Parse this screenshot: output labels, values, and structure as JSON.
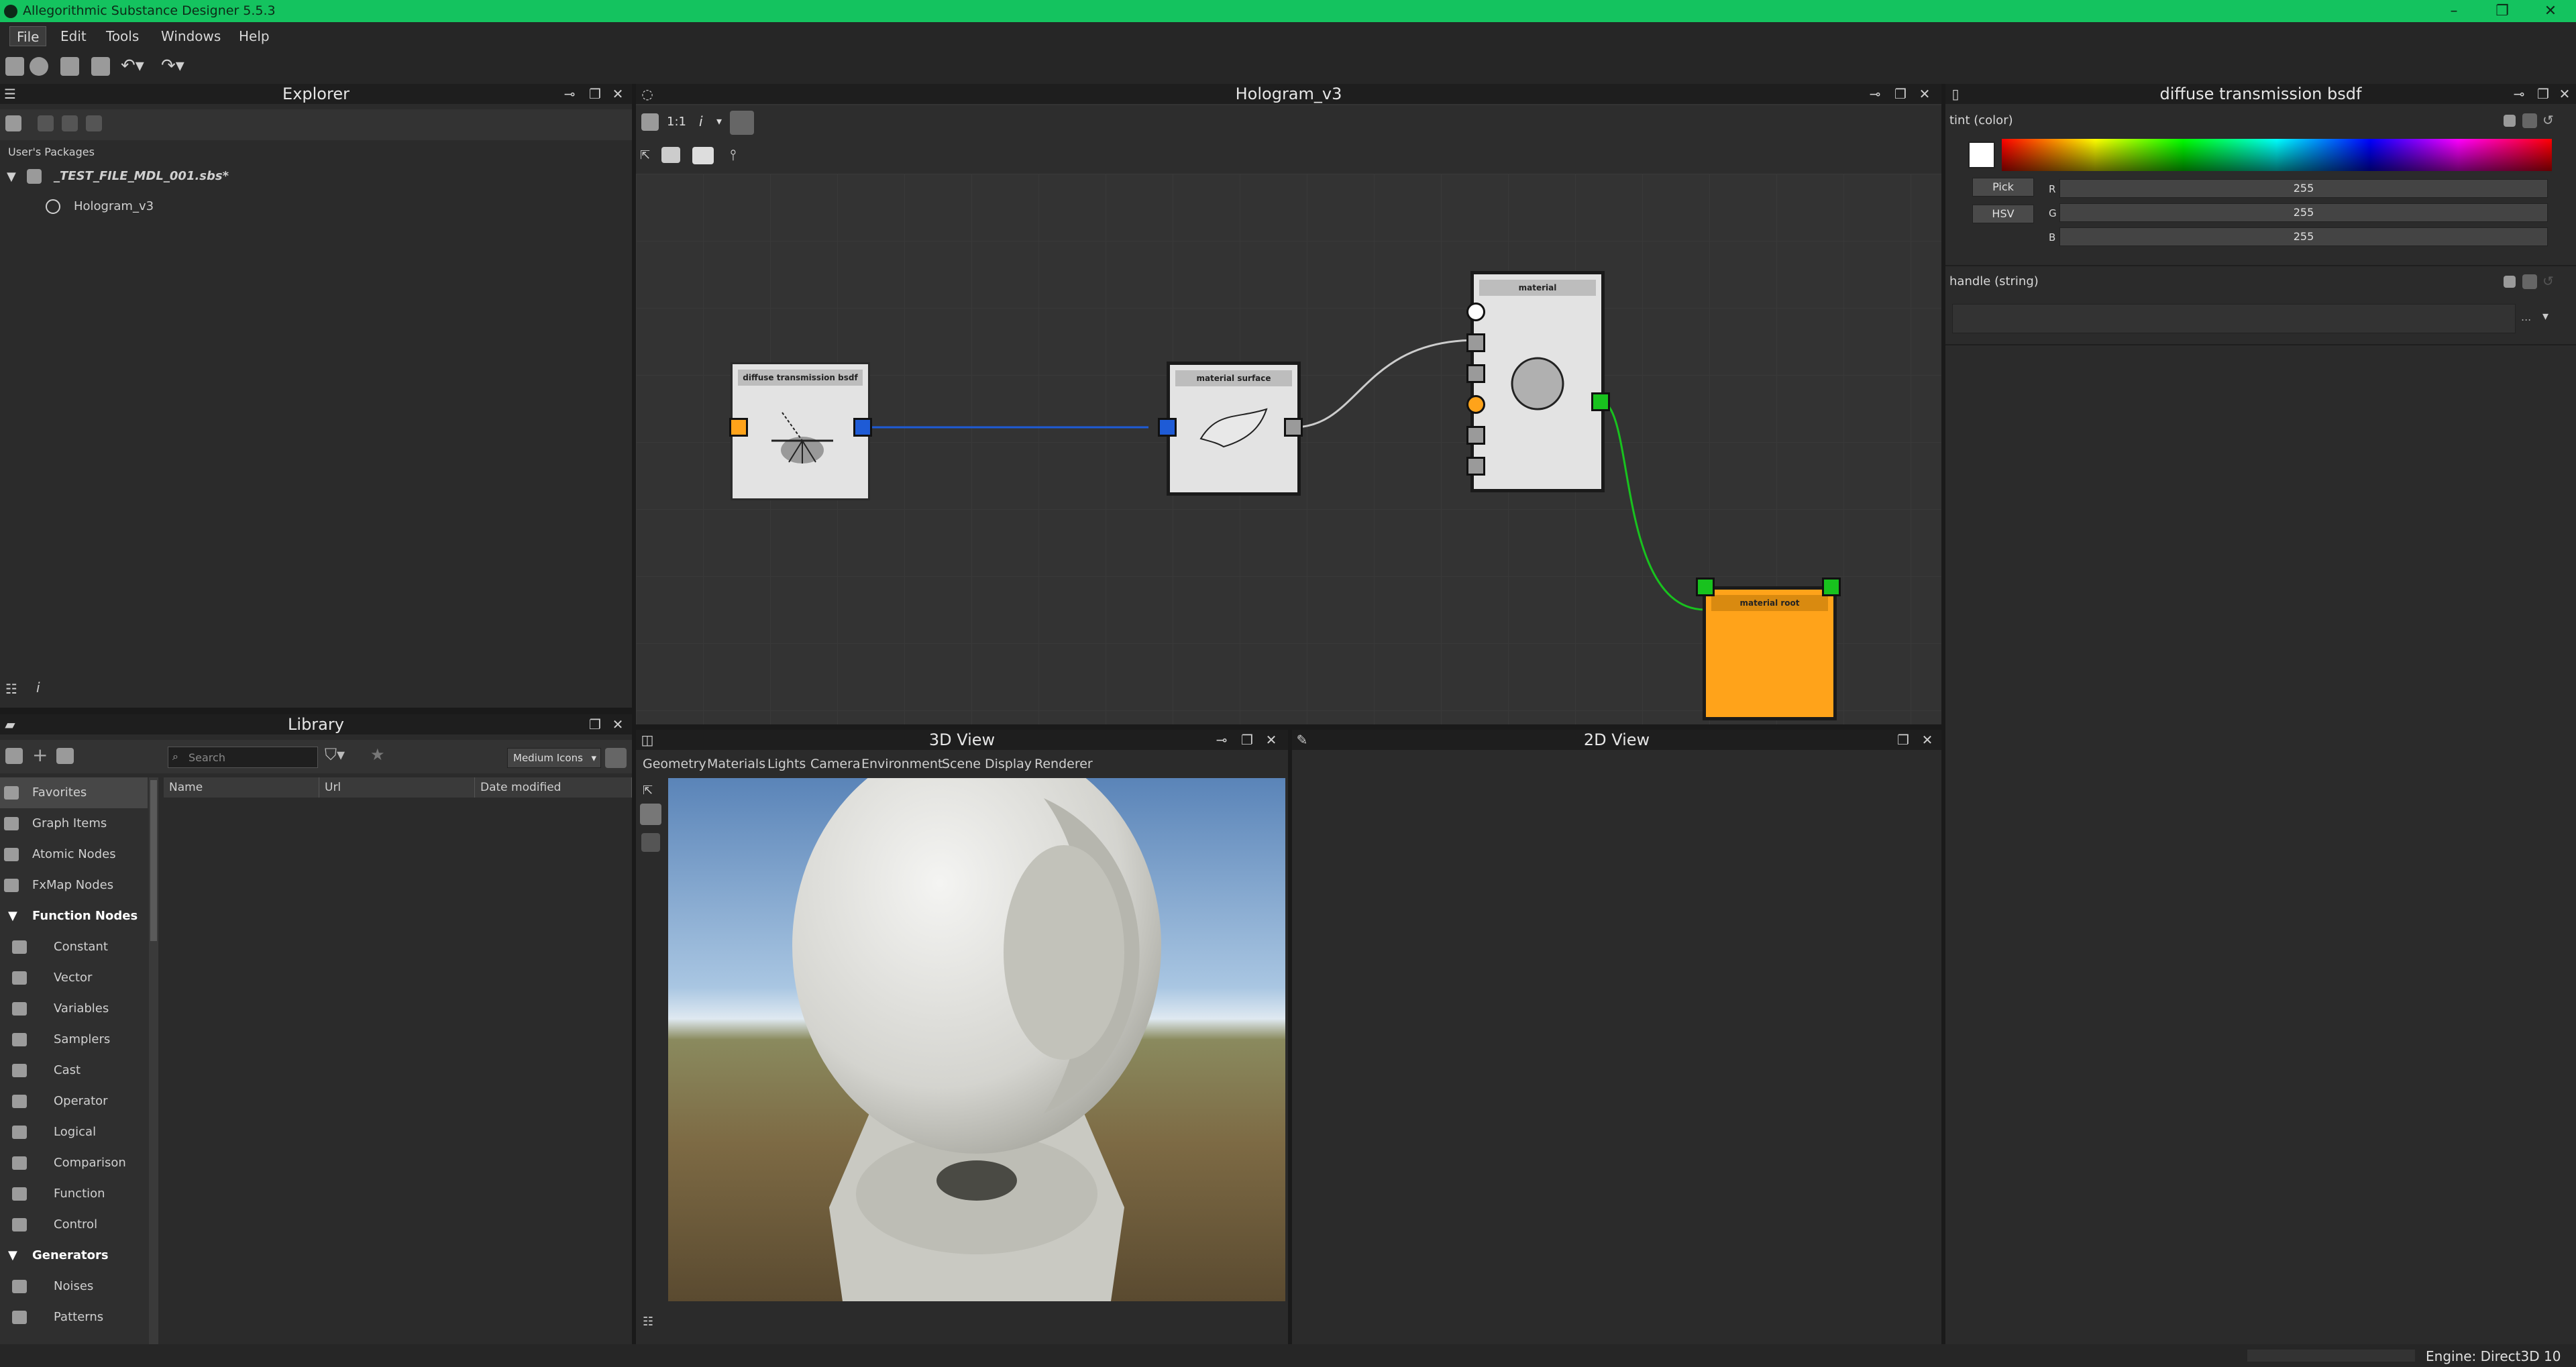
{
  "window": {
    "title": "Allegorithmic Substance Designer 5.5.3"
  },
  "menu": {
    "file": "File",
    "edit": "Edit",
    "tools": "Tools",
    "windows": "Windows",
    "help": "Help"
  },
  "explorer": {
    "title": "Explorer",
    "section": "User's Packages",
    "package": "_TEST_FILE_MDL_001.sbs*",
    "graph": "Hologram_v3"
  },
  "library": {
    "title": "Library",
    "search_placeholder": "Search",
    "view_mode": "Medium Icons",
    "columns": [
      "Name",
      "Url",
      "Date modified"
    ],
    "items": [
      {
        "label": "Favorites",
        "type": "top",
        "selected": true
      },
      {
        "label": "Graph Items",
        "type": "top"
      },
      {
        "label": "Atomic Nodes",
        "type": "top"
      },
      {
        "label": "FxMap Nodes",
        "type": "top"
      },
      {
        "label": "Function Nodes",
        "type": "cat"
      },
      {
        "label": "Constant",
        "type": "sub"
      },
      {
        "label": "Vector",
        "type": "sub"
      },
      {
        "label": "Variables",
        "type": "sub"
      },
      {
        "label": "Samplers",
        "type": "sub"
      },
      {
        "label": "Cast",
        "type": "sub"
      },
      {
        "label": "Operator",
        "type": "sub"
      },
      {
        "label": "Logical",
        "type": "sub"
      },
      {
        "label": "Comparison",
        "type": "sub"
      },
      {
        "label": "Function",
        "type": "sub"
      },
      {
        "label": "Control",
        "type": "sub"
      },
      {
        "label": "Generators",
        "type": "cat"
      },
      {
        "label": "Noises",
        "type": "sub"
      },
      {
        "label": "Patterns",
        "type": "sub"
      }
    ]
  },
  "graph": {
    "title": "Hologram_v3",
    "zoom_label": "1:1",
    "info_label": "i",
    "nodes": {
      "diffuse": "diffuse transmission bsdf",
      "surface": "material surface",
      "material": "material",
      "root": "material root"
    },
    "colors": {
      "blue": "#1e5bd6",
      "orange": "#ffa31a",
      "green": "#18c21e",
      "gray": "#9a9a9a"
    }
  },
  "view3d": {
    "title": "3D View",
    "tabs": [
      "Geometry",
      "Materials",
      "Lights",
      "Camera",
      "Environment",
      "Scene",
      "Display",
      "Renderer"
    ]
  },
  "view2d": {
    "title": "2D View"
  },
  "properties": {
    "title": "diffuse transmission bsdf",
    "tint_label": "tint (color)",
    "pick": "Pick",
    "hsv": "HSV",
    "r_label": "R",
    "r_value": "255",
    "g_label": "G",
    "g_value": "255",
    "b_label": "B",
    "b_value": "255",
    "handle_label": "handle (string)",
    "handle_more": "...",
    "handle_dropdown": "▾"
  },
  "status": {
    "engine": "Engine: Direct3D 10"
  }
}
